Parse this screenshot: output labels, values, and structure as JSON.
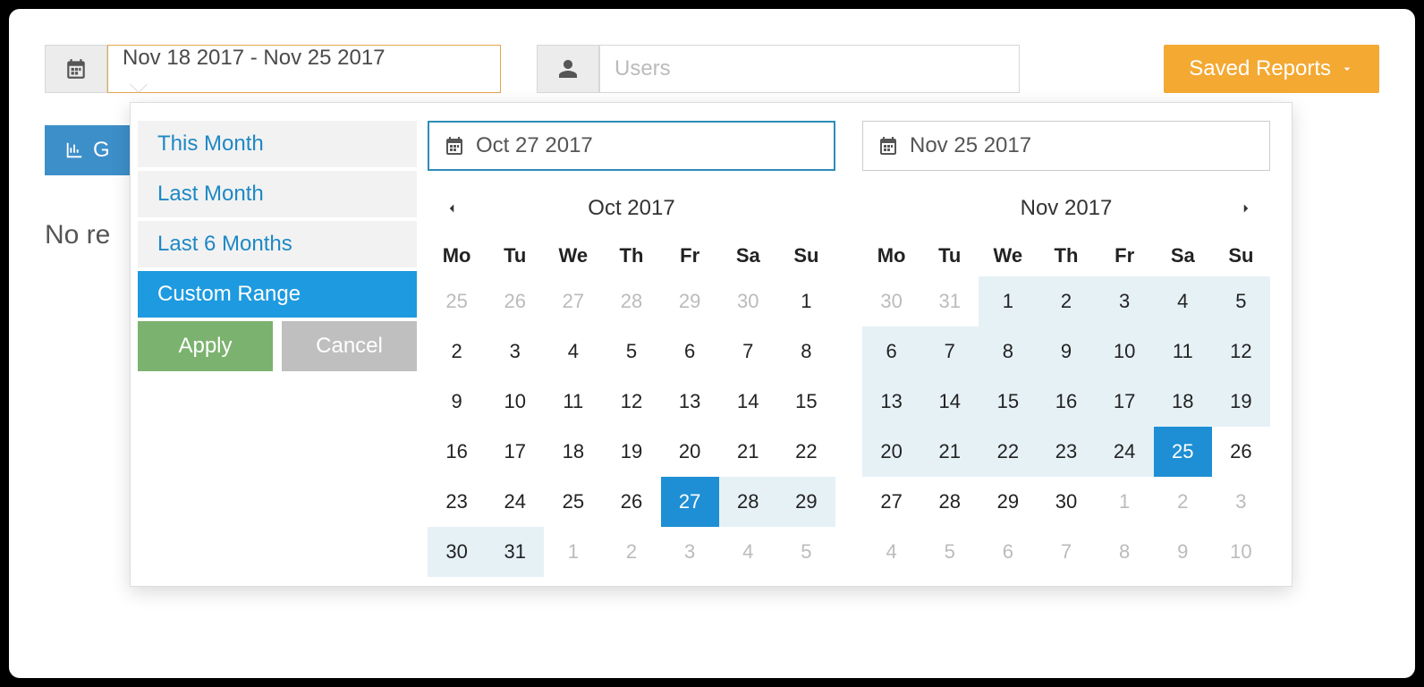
{
  "toolbar": {
    "date_range": "Nov 18 2017 - Nov 25 2017",
    "users_placeholder": "Users",
    "saved_reports_label": "Saved Reports"
  },
  "behind": {
    "button_partial": "G",
    "no_results_partial": "No re"
  },
  "datepicker": {
    "presets": [
      "This Month",
      "Last Month",
      "Last 6 Months",
      "Custom Range"
    ],
    "active_preset_index": 3,
    "apply_label": "Apply",
    "cancel_label": "Cancel",
    "left": {
      "input_value": "Oct 27 2017",
      "focused": true,
      "month_label": "Oct 2017",
      "show_prev": true,
      "show_next": false,
      "weekdays": [
        "Mo",
        "Tu",
        "We",
        "Th",
        "Fr",
        "Sa",
        "Su"
      ],
      "weeks": [
        [
          {
            "d": 25,
            "off": true
          },
          {
            "d": 26,
            "off": true
          },
          {
            "d": 27,
            "off": true
          },
          {
            "d": 28,
            "off": true
          },
          {
            "d": 29,
            "off": true
          },
          {
            "d": 30,
            "off": true
          },
          {
            "d": 1
          }
        ],
        [
          {
            "d": 2
          },
          {
            "d": 3
          },
          {
            "d": 4
          },
          {
            "d": 5
          },
          {
            "d": 6
          },
          {
            "d": 7
          },
          {
            "d": 8
          }
        ],
        [
          {
            "d": 9
          },
          {
            "d": 10
          },
          {
            "d": 11
          },
          {
            "d": 12
          },
          {
            "d": 13
          },
          {
            "d": 14
          },
          {
            "d": 15
          }
        ],
        [
          {
            "d": 16
          },
          {
            "d": 17
          },
          {
            "d": 18
          },
          {
            "d": 19
          },
          {
            "d": 20
          },
          {
            "d": 21
          },
          {
            "d": 22
          }
        ],
        [
          {
            "d": 23
          },
          {
            "d": 24
          },
          {
            "d": 25
          },
          {
            "d": 26
          },
          {
            "d": 27,
            "sel": true
          },
          {
            "d": 28,
            "in": true
          },
          {
            "d": 29,
            "in": true
          }
        ],
        [
          {
            "d": 30,
            "in": true
          },
          {
            "d": 31,
            "in": true
          },
          {
            "d": 1,
            "off": true
          },
          {
            "d": 2,
            "off": true
          },
          {
            "d": 3,
            "off": true
          },
          {
            "d": 4,
            "off": true
          },
          {
            "d": 5,
            "off": true
          }
        ]
      ]
    },
    "right": {
      "input_value": "Nov 25 2017",
      "focused": false,
      "month_label": "Nov 2017",
      "show_prev": false,
      "show_next": true,
      "weekdays": [
        "Mo",
        "Tu",
        "We",
        "Th",
        "Fr",
        "Sa",
        "Su"
      ],
      "weeks": [
        [
          {
            "d": 30,
            "off": true
          },
          {
            "d": 31,
            "off": true
          },
          {
            "d": 1,
            "in": true
          },
          {
            "d": 2,
            "in": true
          },
          {
            "d": 3,
            "in": true
          },
          {
            "d": 4,
            "in": true
          },
          {
            "d": 5,
            "in": true
          }
        ],
        [
          {
            "d": 6,
            "in": true
          },
          {
            "d": 7,
            "in": true
          },
          {
            "d": 8,
            "in": true
          },
          {
            "d": 9,
            "in": true
          },
          {
            "d": 10,
            "in": true
          },
          {
            "d": 11,
            "in": true
          },
          {
            "d": 12,
            "in": true
          }
        ],
        [
          {
            "d": 13,
            "in": true
          },
          {
            "d": 14,
            "in": true
          },
          {
            "d": 15,
            "in": true
          },
          {
            "d": 16,
            "in": true
          },
          {
            "d": 17,
            "in": true
          },
          {
            "d": 18,
            "in": true
          },
          {
            "d": 19,
            "in": true
          }
        ],
        [
          {
            "d": 20,
            "in": true
          },
          {
            "d": 21,
            "in": true
          },
          {
            "d": 22,
            "in": true
          },
          {
            "d": 23,
            "in": true
          },
          {
            "d": 24,
            "in": true
          },
          {
            "d": 25,
            "sel": true
          },
          {
            "d": 26
          }
        ],
        [
          {
            "d": 27
          },
          {
            "d": 28
          },
          {
            "d": 29
          },
          {
            "d": 30
          },
          {
            "d": 1,
            "off": true
          },
          {
            "d": 2,
            "off": true
          },
          {
            "d": 3,
            "off": true
          }
        ],
        [
          {
            "d": 4,
            "off": true
          },
          {
            "d": 5,
            "off": true
          },
          {
            "d": 6,
            "off": true
          },
          {
            "d": 7,
            "off": true
          },
          {
            "d": 8,
            "off": true
          },
          {
            "d": 9,
            "off": true
          },
          {
            "d": 10,
            "off": true
          }
        ]
      ]
    }
  }
}
